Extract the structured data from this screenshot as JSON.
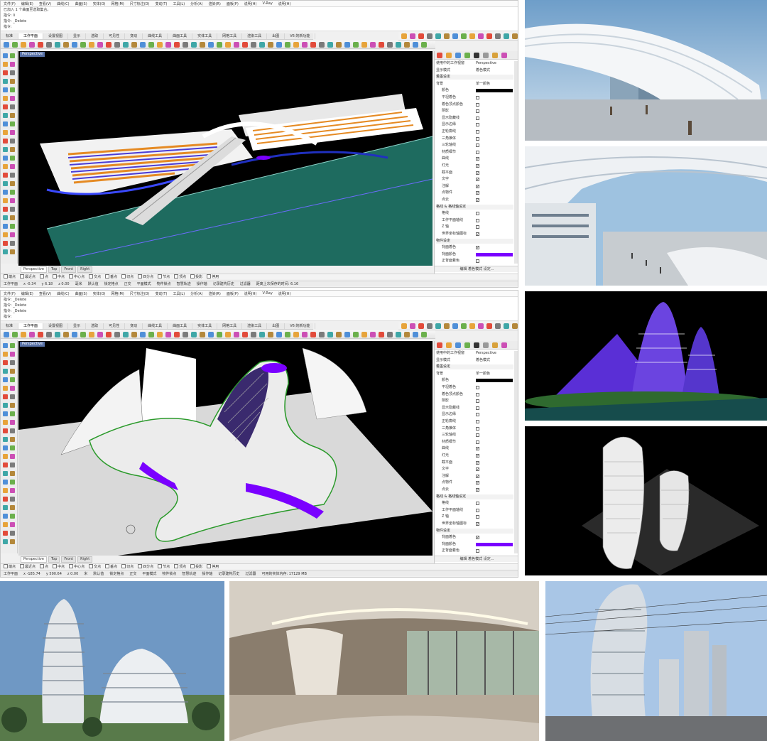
{
  "rhino_top": {
    "menus": [
      "文件(F)",
      "编辑(E)",
      "查看(V)",
      "曲线(C)",
      "曲面(S)",
      "实体(O)",
      "网格(M)",
      "尺寸标注(D)",
      "变动(T)",
      "工具(L)",
      "分析(A)",
      "渲染(R)",
      "面板(P)",
      "说明(H)",
      "V-Ray",
      "说明(H)"
    ],
    "history": [
      "已加入 1 个曲面至选取集合。",
      "指令: Ii",
      "指令: _Delete",
      "指令:"
    ],
    "tabs": [
      "标准",
      "工作平面",
      "设置视图",
      "显示",
      "选取",
      "可见性",
      "变动",
      "曲线工具",
      "曲面工具",
      "实体工具",
      "网格工具",
      "渲染工具",
      "出图",
      "V6 的新功能"
    ],
    "active_tab": "工作平面",
    "viewport_label": "Perspective",
    "viewport_tabs": [
      "Perspective",
      "Top",
      "Front",
      "Right"
    ],
    "osnaps": [
      "端点",
      "最近点",
      "点",
      "中点",
      "中心点",
      "交点",
      "垂点",
      "切点",
      "四分点",
      "节点",
      "顶点",
      "投影",
      "停用"
    ],
    "status": [
      "工作平面",
      "x -0.34",
      "y 6.18",
      "z 0.00",
      "毫米",
      "默认值",
      "锁定格点",
      "正交",
      "平面模式",
      "物件锁点",
      "智慧轨迹",
      "操作轴",
      "记录建构历史",
      "过滤器",
      "距离上次保存的时间: 6.16"
    ]
  },
  "rhino_bottom": {
    "menus": [
      "文件(F)",
      "编辑(E)",
      "查看(V)",
      "曲线(C)",
      "曲面(S)",
      "实体(O)",
      "网格(M)",
      "尺寸标注(D)",
      "变动(T)",
      "工具(L)",
      "分析(A)",
      "渲染(R)",
      "面板(P)",
      "说明(H)",
      "V-Ray",
      "说明(H)"
    ],
    "history": [
      "指令: _Delete",
      "指令: _Delete",
      "指令: _Delete",
      "指令:"
    ],
    "tabs": [
      "标准",
      "工作平面",
      "设置视图",
      "显示",
      "选取",
      "可见性",
      "变动",
      "曲线工具",
      "曲面工具",
      "实体工具",
      "网格工具",
      "渲染工具",
      "出图",
      "V6 的新功能"
    ],
    "active_tab": "工作平面",
    "viewport_label": "Perspective",
    "viewport_tabs": [
      "Perspective",
      "Top",
      "Front",
      "Right"
    ],
    "osnaps": [
      "端点",
      "最近点",
      "点",
      "中点",
      "中心点",
      "交点",
      "垂点",
      "切点",
      "四分点",
      "节点",
      "顶点",
      "投影",
      "停用"
    ],
    "status": [
      "工作平面",
      "x -185.74",
      "y 590.64",
      "z 0.00",
      "米",
      "默认值",
      "锁定格点",
      "正交",
      "平面模式",
      "物件锁点",
      "智慧轨迹",
      "操作轴",
      "记录建构历史",
      "过滤器",
      "可用的实体内存: 17129 MB"
    ]
  },
  "props": {
    "rows": [
      {
        "k": "使用中的工作视窗",
        "v": "Perspective",
        "type": "text"
      },
      {
        "k": "显示模式",
        "v": "着色模式",
        "type": "text"
      },
      {
        "k": "着墨设定",
        "type": "section"
      },
      {
        "k": "背景",
        "v": "单一颜色",
        "type": "text"
      },
      {
        "k": "颜色",
        "type": "swatch",
        "color": "#000000"
      },
      {
        "k": "平坦着色",
        "type": "check",
        "checked": false
      },
      {
        "k": "着色顶点颜色",
        "type": "check",
        "checked": false
      },
      {
        "k": "阴影",
        "type": "check",
        "checked": false
      },
      {
        "k": "显示隐藏线",
        "type": "check",
        "checked": false
      },
      {
        "k": "显示边缘",
        "type": "check",
        "checked": false
      },
      {
        "k": "正轮廓线",
        "type": "check",
        "checked": false
      },
      {
        "k": "三角锥体",
        "type": "check",
        "checked": false
      },
      {
        "k": "三轮轴线",
        "type": "check",
        "checked": false
      },
      {
        "k": "材质细节",
        "type": "check",
        "checked": false
      },
      {
        "k": "曲线",
        "type": "check",
        "checked": true
      },
      {
        "k": "灯光",
        "type": "check",
        "checked": true
      },
      {
        "k": "截平面",
        "type": "check",
        "checked": true
      },
      {
        "k": "文字",
        "type": "check",
        "checked": true
      },
      {
        "k": "注解",
        "type": "check",
        "checked": true
      },
      {
        "k": "点物件",
        "type": "check",
        "checked": true
      },
      {
        "k": "点云",
        "type": "check",
        "checked": true
      },
      {
        "k": "格线 & 格线轴设定",
        "type": "section"
      },
      {
        "k": "格线",
        "type": "check",
        "checked": false
      },
      {
        "k": "工作平面轴线",
        "type": "check",
        "checked": false
      },
      {
        "k": "Z 轴",
        "type": "check",
        "checked": false
      },
      {
        "k": "世界坐标轴图标",
        "type": "check",
        "checked": true
      },
      {
        "k": "物件设定",
        "type": "section"
      },
      {
        "k": "背面着色",
        "type": "check",
        "checked": true
      },
      {
        "k": "背面颜色",
        "type": "swatch",
        "color": "#7a00ff"
      },
      {
        "k": "正背面着色",
        "type": "check",
        "checked": false
      }
    ],
    "footer": "编辑 着色模式 设定..."
  },
  "colors": {
    "viewport_bg": "#000000",
    "tab_accent": "#5a73a8",
    "violet": "#7a00ff",
    "orange": "#e58a23",
    "teal": "#1e6b5f"
  },
  "icons": [
    "select-icon",
    "point-icon",
    "curve-icon",
    "circle-icon",
    "surface-icon",
    "solid-icon",
    "mesh-icon",
    "transform-icon",
    "analyze-icon",
    "render-icon"
  ]
}
